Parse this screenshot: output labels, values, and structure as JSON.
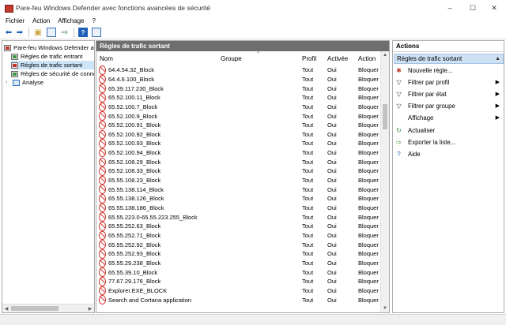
{
  "window": {
    "title": "Pare-feu Windows Defender avec fonctions avancées de sécurité",
    "minimize": "–",
    "maximize": "☐",
    "close": "✕"
  },
  "menu": [
    "Fichier",
    "Action",
    "Affichage",
    "?"
  ],
  "toolbar": {
    "icons": [
      "back-arrow-icon",
      "forward-arrow-icon",
      "folder-up-icon",
      "properties-icon",
      "export-icon",
      "help-icon",
      "panel-icon"
    ],
    "help_label": "?"
  },
  "tree": {
    "root": "Pare-feu Windows Defender avec",
    "items": [
      {
        "label": "Règles de trafic entrant",
        "icon": "inbound-rules-icon"
      },
      {
        "label": "Règles de trafic sortant",
        "icon": "outbound-rules-icon",
        "selected": true
      },
      {
        "label": "Règles de sécurité de connex",
        "icon": "connection-security-icon"
      },
      {
        "label": "Analyse",
        "icon": "monitoring-icon",
        "expander": "›"
      }
    ]
  },
  "center": {
    "title": "Règles de trafic sortant",
    "columns": {
      "nom": "Nom",
      "groupe": "Groupe",
      "profil": "Profil",
      "activee": "Activée",
      "action": "Action"
    },
    "sort_arrow": "^",
    "rows": [
      {
        "name": "64.4.54.32_Block",
        "profil": "Tout",
        "activee": "Oui",
        "action": "Bloquer"
      },
      {
        "name": "64.4.6.100_Block",
        "profil": "Tout",
        "activee": "Oui",
        "action": "Bloquer"
      },
      {
        "name": "65.39.117.230_Block",
        "profil": "Tout",
        "activee": "Oui",
        "action": "Bloquer"
      },
      {
        "name": "65.52.100.11_Block",
        "profil": "Tout",
        "activee": "Oui",
        "action": "Bloquer"
      },
      {
        "name": "65.52.100.7_Block",
        "profil": "Tout",
        "activee": "Oui",
        "action": "Bloquer"
      },
      {
        "name": "65.52.100.9_Block",
        "profil": "Tout",
        "activee": "Oui",
        "action": "Bloquer"
      },
      {
        "name": "65.52.100.91_Block",
        "profil": "Tout",
        "activee": "Oui",
        "action": "Bloquer"
      },
      {
        "name": "65.52.100.92_Block",
        "profil": "Tout",
        "activee": "Oui",
        "action": "Bloquer"
      },
      {
        "name": "65.52.100.93_Block",
        "profil": "Tout",
        "activee": "Oui",
        "action": "Bloquer"
      },
      {
        "name": "65.52.100.94_Block",
        "profil": "Tout",
        "activee": "Oui",
        "action": "Bloquer"
      },
      {
        "name": "65.52.108.29_Block",
        "profil": "Tout",
        "activee": "Oui",
        "action": "Bloquer"
      },
      {
        "name": "65.52.108.33_Block",
        "profil": "Tout",
        "activee": "Oui",
        "action": "Bloquer"
      },
      {
        "name": "65.55.108.23_Block",
        "profil": "Tout",
        "activee": "Oui",
        "action": "Bloquer"
      },
      {
        "name": "65.55.138.114_Block",
        "profil": "Tout",
        "activee": "Oui",
        "action": "Bloquer"
      },
      {
        "name": "65.55.138.126_Block",
        "profil": "Tout",
        "activee": "Oui",
        "action": "Bloquer"
      },
      {
        "name": "65.55.138.186_Block",
        "profil": "Tout",
        "activee": "Oui",
        "action": "Bloquer"
      },
      {
        "name": "65.55.223.0-65.55.223.255_Block",
        "profil": "Tout",
        "activee": "Oui",
        "action": "Bloquer"
      },
      {
        "name": "65.55.252.63_Block",
        "profil": "Tout",
        "activee": "Oui",
        "action": "Bloquer"
      },
      {
        "name": "65.55.252.71_Block",
        "profil": "Tout",
        "activee": "Oui",
        "action": "Bloquer"
      },
      {
        "name": "65.55.252.92_Block",
        "profil": "Tout",
        "activee": "Oui",
        "action": "Bloquer"
      },
      {
        "name": "65.55.252.93_Block",
        "profil": "Tout",
        "activee": "Oui",
        "action": "Bloquer"
      },
      {
        "name": "65.55.29.238_Block",
        "profil": "Tout",
        "activee": "Oui",
        "action": "Bloquer"
      },
      {
        "name": "65.55.39.10_Block",
        "profil": "Tout",
        "activee": "Oui",
        "action": "Bloquer"
      },
      {
        "name": "77.67.29.176_Block",
        "profil": "Tout",
        "activee": "Oui",
        "action": "Bloquer"
      },
      {
        "name": "Explorer.EXE_BLOCK",
        "profil": "Tout",
        "activee": "Oui",
        "action": "Bloquer"
      },
      {
        "name": "Search  and  Cortana  application",
        "profil": "Tout",
        "activee": "Oui",
        "action": "Bloquer"
      }
    ]
  },
  "actions": {
    "title": "Actions",
    "section": "Règles de trafic sortant",
    "section_caret": "▲",
    "items": [
      {
        "label": "Nouvelle règle...",
        "icon": "new-rule-icon",
        "glyph": "✱",
        "color": "#c0392b"
      },
      {
        "label": "Filtrer par profil",
        "icon": "filter-icon",
        "glyph": "▽",
        "color": "#333333",
        "submenu": "▶"
      },
      {
        "label": "Filtrer par état",
        "icon": "filter-icon",
        "glyph": "▽",
        "color": "#333333",
        "submenu": "▶"
      },
      {
        "label": "Filtrer par groupe",
        "icon": "filter-icon",
        "glyph": "▽",
        "color": "#333333",
        "submenu": "▶"
      },
      {
        "label": "Affichage",
        "icon": "view-icon",
        "glyph": "",
        "color": "#333333",
        "submenu": "▶"
      },
      {
        "label": "Actualiser",
        "icon": "refresh-icon",
        "glyph": "↻",
        "color": "#2e8b3e"
      },
      {
        "label": "Exporter la liste...",
        "icon": "export-list-icon",
        "glyph": "⇨",
        "color": "#2e7d32"
      },
      {
        "label": "Aide",
        "icon": "help-icon",
        "glyph": "?",
        "color": "#1f5fb8"
      }
    ]
  }
}
